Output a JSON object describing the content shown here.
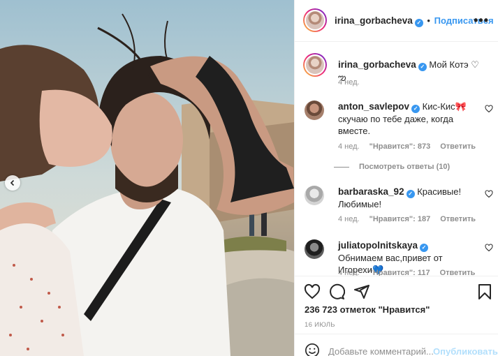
{
  "post": {
    "author": "irina_gorbacheva",
    "follow_label": "Подписаться",
    "more_label": "•••",
    "separator": "•",
    "caption_author": "irina_gorbacheva",
    "caption_text": "Мой Котэ ♡ ఌ",
    "caption_age": "4 нед.",
    "likes": "236 723 отметок \"Нравится\"",
    "date": "16 ИЮЛЬ",
    "add_comment_placeholder": "Добавьте комментарий...",
    "publish_label": "Опубликовать"
  },
  "comments": [
    {
      "user": "anton_savlepov",
      "text": "Кис-Кис🎀 скучаю по тебе даже, когда вместе.",
      "age": "4 нед.",
      "likes": "\"Нравится\": 873",
      "reply": "Ответить"
    },
    {
      "user": "barbaraska_92",
      "text": "Красивые! Любимые!",
      "age": "4 нед.",
      "likes": "\"Нравится\": 187",
      "reply": "Ответить"
    },
    {
      "user": "juliatopolnitskaya",
      "text": "Обнимаем вас,привет от Игорехи💙",
      "age": "4 нед.",
      "likes": "\"Нравится\": 117",
      "reply": "Ответить"
    }
  ],
  "view_replies": "Посмотреть ответы (10)",
  "icons": {
    "like": "heart-icon",
    "comment": "comment-icon",
    "share": "share-icon",
    "save": "bookmark-icon",
    "emoji": "smiley-icon",
    "prev": "chevron-left-icon",
    "verified": "verified-badge-icon"
  },
  "colors": {
    "accent": "#3897f0",
    "muted": "#8e8e8e",
    "text": "#262626",
    "publish_disabled": "#b2dffc"
  }
}
